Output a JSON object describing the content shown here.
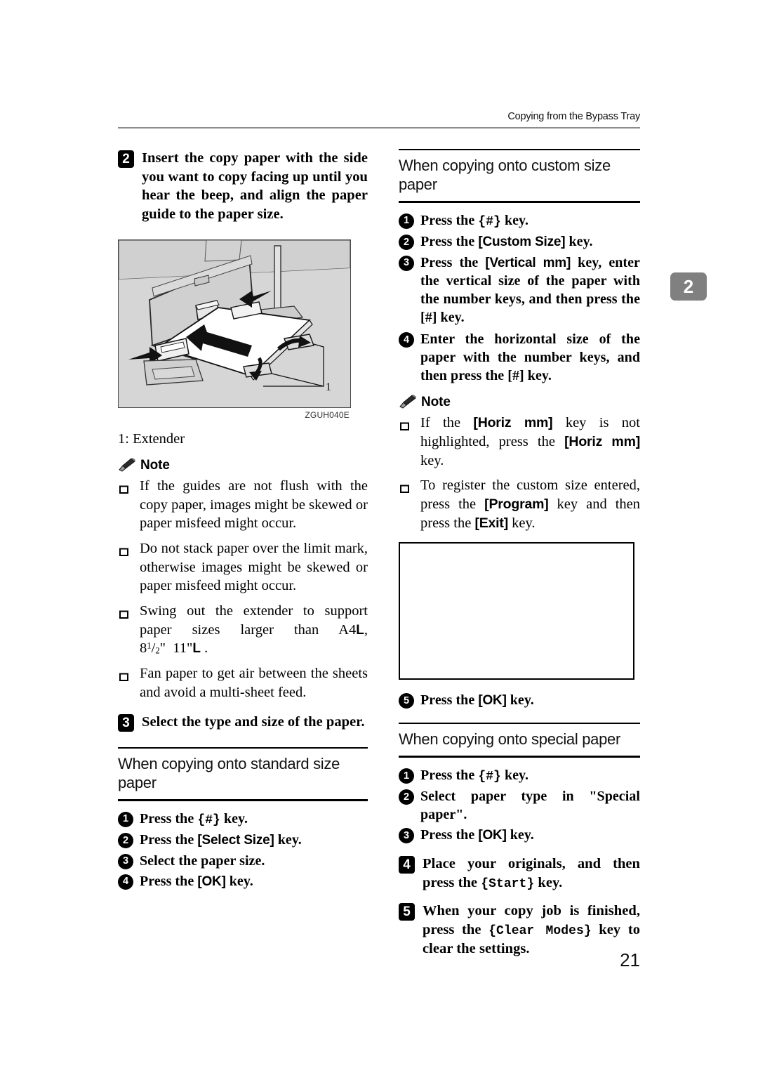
{
  "header": {
    "running_title": "Copying from the Bypass Tray"
  },
  "chapter_tab": {
    "number": "2"
  },
  "folio": {
    "page_number": "21"
  },
  "left_column": {
    "step2": {
      "number": "2",
      "text": "Insert the copy paper with the side you want to copy facing up until you hear the beep, and align the paper guide to the paper size."
    },
    "figure": {
      "code": "ZGUH040E",
      "callout_number": "1",
      "caption": "1: Extender"
    },
    "note": {
      "label": "Note",
      "items": [
        "If the guides are not flush with the copy paper, images might be skewed or paper misfeed might occur.",
        "Do not stack paper over the limit mark, otherwise images might be skewed or paper misfeed might occur.",
        "Fan paper to get air between the sheets and avoid a multi-sheet feed."
      ],
      "item_swing": {
        "prefix": "Swing out the extender to support paper sizes larger than A4",
        "orient1": "L",
        "mid": ", 8",
        "frac_num": "1",
        "frac_den": "2",
        "inch1": "\"",
        "width": "11\"",
        "orient2": "L",
        "suffix": "."
      }
    },
    "step3": {
      "number": "3",
      "text": "Select the type and size of the paper."
    },
    "section_standard": {
      "heading": "When copying onto standard size paper",
      "substeps": [
        {
          "number": "1",
          "pre": "Press the ",
          "key": "{#}",
          "post": " key."
        },
        {
          "number": "2",
          "pre": "Press the ",
          "key": "[Select Size]",
          "post": " key."
        },
        {
          "number": "3",
          "pre": "Select the paper size.",
          "key": "",
          "post": ""
        },
        {
          "number": "4",
          "pre": "Press the ",
          "key": "[OK]",
          "post": " key."
        }
      ]
    }
  },
  "right_column": {
    "section_custom": {
      "heading": "When copying onto custom size paper",
      "substeps": [
        {
          "number": "1",
          "pre": "Press the ",
          "key": "{#}",
          "post": " key."
        },
        {
          "number": "2",
          "pre": "Press the ",
          "key": "[Custom Size]",
          "post": " key."
        },
        {
          "number": "3",
          "pre": "Press the ",
          "key": "[Vertical mm]",
          "post": " key, enter the vertical size of the paper with the number keys, and then press the [#] key."
        },
        {
          "number": "4",
          "pre": "Enter the horizontal size of the paper with the number keys, and then press the [#] key.",
          "key": "",
          "post": ""
        }
      ],
      "note": {
        "label": "Note",
        "items": [
          {
            "text_a": "If the ",
            "key_a": "[Horiz mm]",
            "text_b": " key is not highlighted, press the ",
            "key_b": "[Horiz mm]",
            "text_c": " key."
          },
          {
            "text_a": "To register the custom size entered, press the ",
            "key_a": "[Program]",
            "text_b": " key and then press the ",
            "key_b": "[Exit]",
            "text_c": " key."
          }
        ]
      },
      "final_substep": {
        "number": "5",
        "pre": "Press the ",
        "key": "[OK]",
        "post": " key."
      }
    },
    "section_special": {
      "heading": "When copying onto special paper",
      "substeps": [
        {
          "number": "1",
          "pre": "Press the ",
          "key": "{#}",
          "post": " key."
        },
        {
          "number": "2",
          "pre": "Select paper type in \"Special paper\".",
          "key": "",
          "post": ""
        },
        {
          "number": "3",
          "pre": "Press the ",
          "key": "[OK]",
          "post": " key."
        }
      ]
    },
    "step4": {
      "number": "4",
      "pre": "Place your originals, and then press the ",
      "key": "{Start}",
      "post": " key."
    },
    "step5": {
      "number": "5",
      "pre": "When your copy job is finished, press the ",
      "key": "{Clear Modes}",
      "post": " key to clear the settings."
    }
  }
}
